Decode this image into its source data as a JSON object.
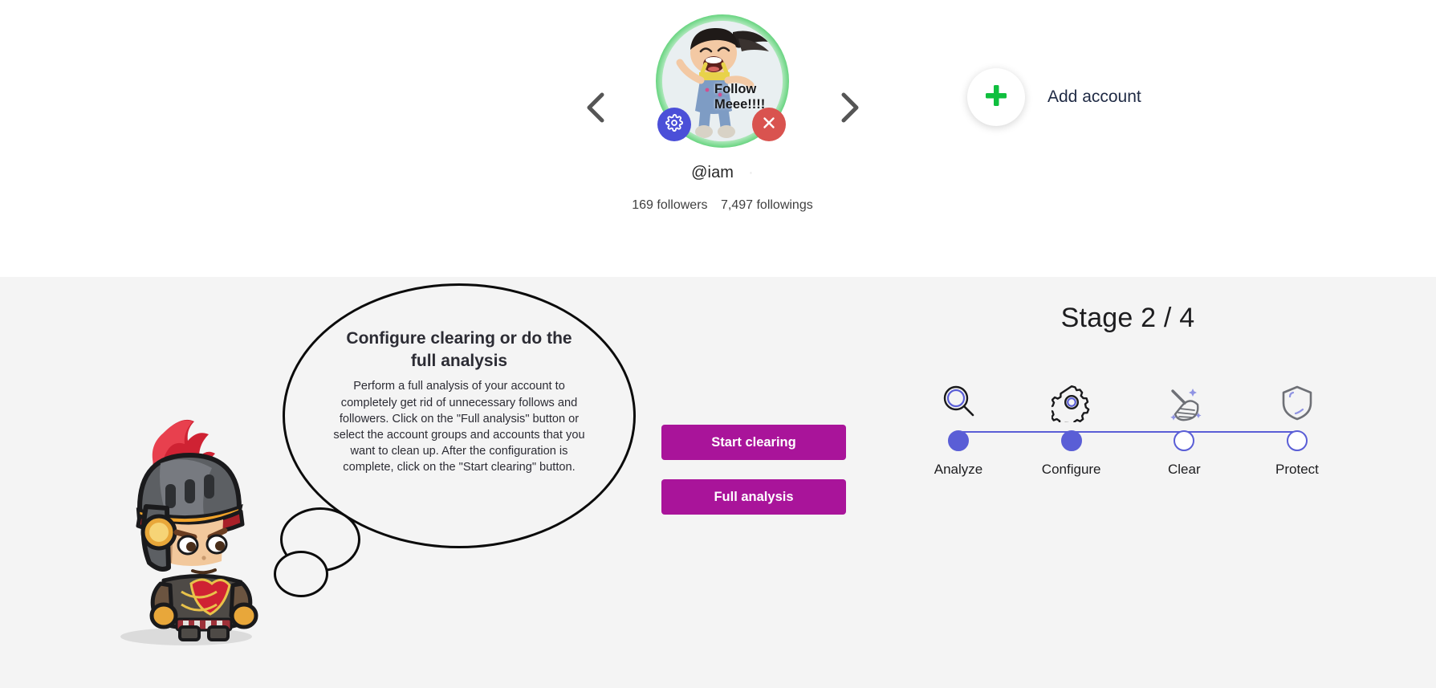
{
  "account_bar": {
    "prev_icon": "chevron-left-icon",
    "next_icon": "chevron-right-icon",
    "avatar": {
      "alt": "profile-avatar",
      "overlay_text_line1": "Follow",
      "overlay_text_line2": "Meee!!!!",
      "ring_color": "#3dc85c",
      "settings_icon": "gear-icon",
      "settings_color": "#4b4fd8",
      "remove_icon": "close-icon",
      "remove_color": "#d9534f"
    },
    "handle": "@iam",
    "handle_suffix": "·",
    "followers": "169 followers",
    "followings": "7,497 followings",
    "add_account_label": "Add account",
    "add_account_icon": "plus-icon",
    "add_account_icon_color": "#0fbf3e"
  },
  "panel": {
    "background": "#f4f4f4",
    "mascot_icon": "knight-mascot",
    "bubble": {
      "title": "Configure clearing or do the full analysis",
      "body": "Perform a full analysis of your account to completely get rid of unnecessary follows and followers. Click on the \"Full analysis\" button or select the account groups and accounts that you want to clean up. After the configuration is complete, click on the \"Start clearing\" button."
    },
    "actions": {
      "start_clearing": "Start clearing",
      "full_analysis": "Full analysis",
      "color": "#a9149a"
    },
    "stage": {
      "title": "Stage 2 / 4",
      "current": 2,
      "total": 4,
      "accent_color": "#5a5ed6",
      "steps": [
        {
          "label": "Analyze",
          "icon": "magnifier-icon",
          "done": true
        },
        {
          "label": "Configure",
          "icon": "gear-icon",
          "done": true
        },
        {
          "label": "Clear",
          "icon": "broom-icon",
          "done": false
        },
        {
          "label": "Protect",
          "icon": "shield-icon",
          "done": false
        }
      ]
    }
  }
}
